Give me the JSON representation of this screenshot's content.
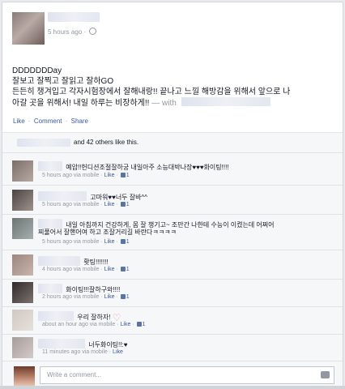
{
  "post": {
    "timestamp": "5 hours ago",
    "text_line1": "DDDDDDDay",
    "text_line2": "잘보고 잘찍고 잘읽고 잘하GO",
    "text_line3": "든든히 챙겨입고 각자시험장에서 잘해내랑!! 끝나고 느낄 해방감을 위해서 앞으로 나",
    "text_line4": "아갈 곳을 위해서! 내일 하루는 비장하게!!",
    "with_label": "— with",
    "actions": {
      "like": "Like",
      "comment": "Comment",
      "share": "Share",
      "sep": "·"
    },
    "likes_text": "and 42 others like this."
  },
  "comments": [
    {
      "text": "예압!!헌디션조절잘하궁 내일아주 소능대박나장♥♥♥화이팅!!!!",
      "time": "5 hours ago via mobile",
      "like": "Like",
      "count": "1"
    },
    {
      "text": "고마워♥♥너두 잘바^^",
      "time": "5 hours ago via mobile",
      "like": "Like",
      "count": "1"
    },
    {
      "text": "내일 아침까지 건강하게, 몸 잘 챙기고~ 조만간 나한테 수능이 이켰는데 어쩌어",
      "text2": "찌풀어서 잘핸어여 하고 조잘거리길 바란다ㅋㅋㅋㅋ",
      "time": "5 hours ago via mobile",
      "like": "Like",
      "count": "1"
    },
    {
      "text": "홧팅!!!!!!!",
      "time": "4 hours ago via mobile",
      "like": "Like",
      "count": "1"
    },
    {
      "text": "화이팅!!!잘하구와!!!!",
      "time": "2 hours ago via mobile",
      "like": "Like",
      "count": "1"
    },
    {
      "text": "우리 잘하자!",
      "time": "about an hour ago via mobile",
      "like": "Like",
      "count": "1"
    },
    {
      "text": "너두화이팅!!:♥",
      "time": "11 minutes ago via mobile",
      "like": "Like"
    }
  ],
  "write_placeholder": "Write a comment..."
}
